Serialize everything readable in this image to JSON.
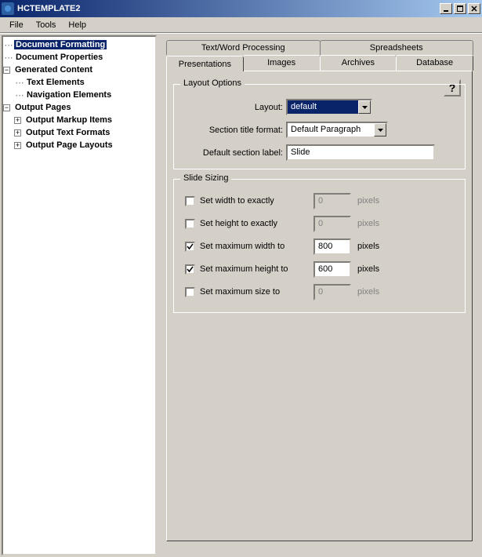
{
  "window": {
    "title": "HCTEMPLATE2",
    "min": "_",
    "max": "□",
    "close": "×"
  },
  "menu": {
    "file": "File",
    "tools": "Tools",
    "help": "Help"
  },
  "tree": {
    "docFormatting": "Document Formatting",
    "docProperties": "Document Properties",
    "genContent": "Generated Content",
    "textElements": "Text Elements",
    "navElements": "Navigation Elements",
    "outputPages": "Output Pages",
    "outMarkup": "Output Markup Items",
    "outTextFmt": "Output Text Formats",
    "outPageLay": "Output Page Layouts"
  },
  "tabs": {
    "textword": "Text/Word Processing",
    "spreadsheets": "Spreadsheets",
    "presentations": "Presentations",
    "images": "Images",
    "archives": "Archives",
    "database": "Database"
  },
  "helpBtn": "?",
  "layoutOptions": {
    "legend": "Layout Options",
    "layoutLabel": "Layout:",
    "layoutValue": "default",
    "sectionTitleLabel": "Section title format:",
    "sectionTitleValue": "Default Paragraph",
    "defaultSectionLabel": "Default section label:",
    "defaultSectionValue": "Slide"
  },
  "slideSizing": {
    "legend": "Slide Sizing",
    "rows": [
      {
        "label": "Set width to exactly",
        "checked": false,
        "value": "0",
        "unit": "pixels"
      },
      {
        "label": "Set height to exactly",
        "checked": false,
        "value": "0",
        "unit": "pixels"
      },
      {
        "label": "Set maximum width to",
        "checked": true,
        "value": "800",
        "unit": "pixels"
      },
      {
        "label": "Set maximum height to",
        "checked": true,
        "value": "600",
        "unit": "pixels"
      },
      {
        "label": "Set maximum size to",
        "checked": false,
        "value": "0",
        "unit": "pixels"
      }
    ]
  }
}
